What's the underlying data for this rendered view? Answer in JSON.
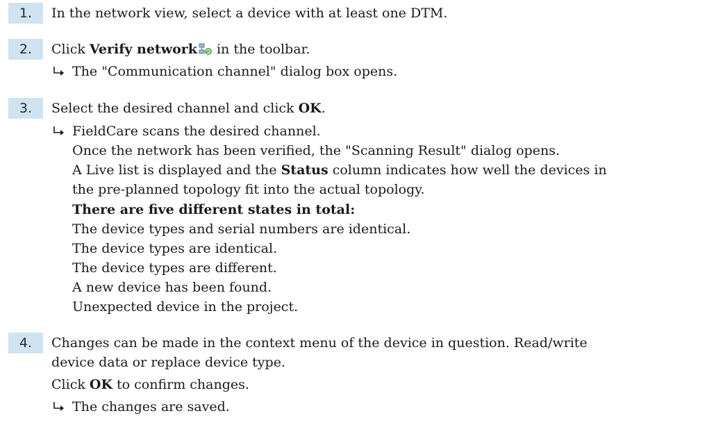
{
  "steps": [
    {
      "number": "1.",
      "text": "In the network view, select a device with at least one DTM."
    },
    {
      "number": "2.",
      "text_before": "Click ",
      "bold": "Verify network",
      "icon": "verify-network-icon",
      "text_after": " in the toolbar.",
      "result": "The \"Communication channel\" dialog box opens."
    },
    {
      "number": "3.",
      "text_before": "Select the desired channel and click ",
      "bold": "OK",
      "text_after": ".",
      "result": "FieldCare scans the desired channel.",
      "result_lines": [
        "Once the network has been verified, the \"Scanning Result\" dialog opens."
      ],
      "live_list_line1_before": "A Live list is displayed and the ",
      "live_list_bold": "Status",
      "live_list_line1_after": " column indicates how well the devices in",
      "live_list_line2": "the pre-planned topology fit into the actual topology.",
      "states_heading": "There are five different states in total:",
      "states": [
        "The device types and serial numbers are identical.",
        "The device types are identical.",
        "The device types are different.",
        "A new device has been found.",
        "Unexpected device in the project."
      ]
    },
    {
      "number": "4.",
      "line1": "Changes can be made in the context menu of the device in question. Read/write",
      "line2": "device data or replace device type.",
      "confirm_before": "Click ",
      "confirm_bold": "OK",
      "confirm_after": " to confirm changes.",
      "result": "The changes are saved."
    }
  ],
  "colors": {
    "step_number_background": "#cfe3f1",
    "text": "#1a1a1a"
  }
}
